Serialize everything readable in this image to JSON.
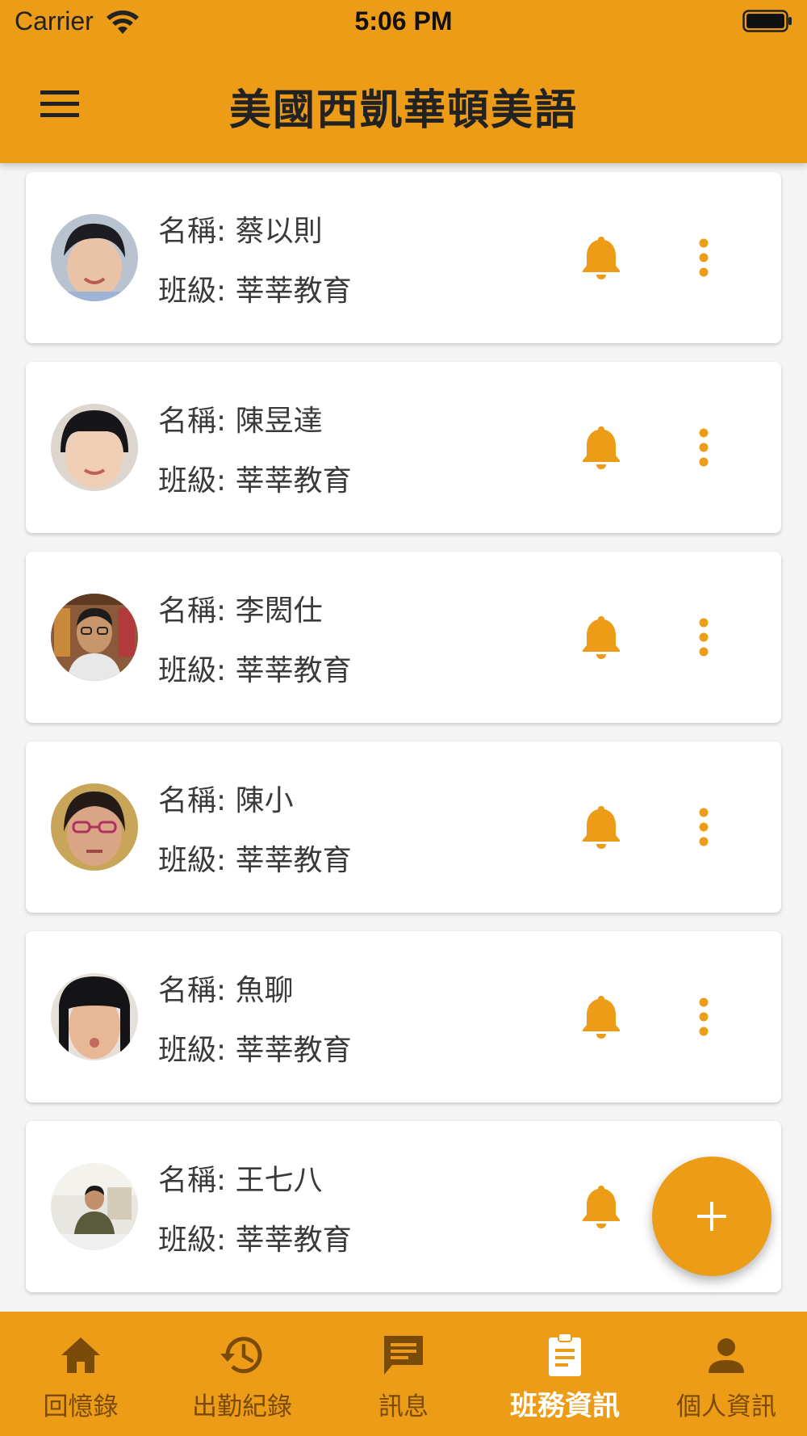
{
  "status_bar": {
    "carrier": "Carrier",
    "time": "5:06 PM"
  },
  "app_bar": {
    "title": "美國西凱華頓美語",
    "menu_icon": "hamburger-menu-icon"
  },
  "colors": {
    "primary": "#EC9C17",
    "nav_inactive": "#7A4A08",
    "nav_active": "#FFFFFF"
  },
  "students": [
    {
      "name_label": "名稱: 蔡以則",
      "class_label": "班級: 莘莘教育"
    },
    {
      "name_label": "名稱: 陳昱達",
      "class_label": "班級: 莘莘教育"
    },
    {
      "name_label": "名稱: 李閎仕",
      "class_label": "班級: 莘莘教育"
    },
    {
      "name_label": "名稱: 陳小",
      "class_label": "班級: 莘莘教育"
    },
    {
      "name_label": "名稱: 魚聊",
      "class_label": "班級: 莘莘教育"
    },
    {
      "name_label": "名稱: 王七八",
      "class_label": "班級: 莘莘教育"
    }
  ],
  "fab": {
    "icon": "plus-icon"
  },
  "bottom_nav": {
    "items": [
      {
        "label": "回憶錄",
        "icon": "home-icon",
        "active": false
      },
      {
        "label": "出勤紀錄",
        "icon": "history-icon",
        "active": false
      },
      {
        "label": "訊息",
        "icon": "message-icon",
        "active": false
      },
      {
        "label": "班務資訊",
        "icon": "clipboard-icon",
        "active": true
      },
      {
        "label": "個人資訊",
        "icon": "person-icon",
        "active": false
      }
    ]
  }
}
